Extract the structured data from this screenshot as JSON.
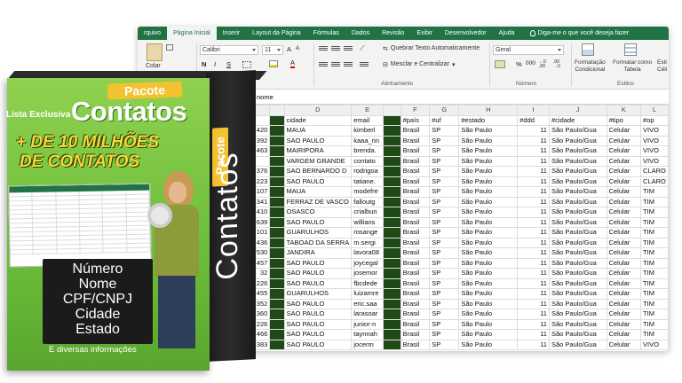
{
  "excel": {
    "menu": [
      "rquivo",
      "Página Inicial",
      "Inserir",
      "Layout da Página",
      "Fórmulas",
      "Dados",
      "Revisão",
      "Exibir",
      "Desenvolvedor",
      "Ajuda"
    ],
    "active_menu": "Página Inicial",
    "tell_me": "Diga-me o que você deseja fazer",
    "ribbon": {
      "paste": "Colar",
      "font_name": "Calibri",
      "font_size": "11",
      "bold": "N",
      "italic": "I",
      "underline": "S",
      "grow_font": "A",
      "shrink_font": "A",
      "font_color": "A",
      "font_group_partial": "onte",
      "wrap_text": "Quebrar Texto Automaticamente",
      "merge_center": "Mesclar e Centralizar",
      "alignment_group": "Alinhamento",
      "number_format": "Geral",
      "percent": "%",
      "thousands": "000",
      "inc_decimal": "←0 ,00",
      "dec_decimal": ",00 →0",
      "number_group": "Número",
      "conditional": [
        "Formatação",
        "Condicional"
      ],
      "format_table": [
        "Formatar como",
        "Tabela"
      ],
      "cell_styles_partial": [
        "Esti",
        "Céli"
      ],
      "styles_group": "Estilos"
    },
    "formula_value": "nome",
    "columns": [
      "C",
      "D",
      "E",
      "F",
      "G",
      "H",
      "I",
      "J",
      "K",
      "L"
    ],
    "header_row": [
      "cnpj",
      "cidade",
      "email",
      "#país",
      "#uf",
      "#estado",
      "#ddd",
      "#cidade",
      "#tipo",
      "#op"
    ],
    "rows": [
      [
        "420",
        "MAUA",
        "kimberl",
        "Brasil",
        "SP",
        "São Paulo",
        "11",
        "São Paulo/Gua",
        "Celular",
        "VIVO"
      ],
      [
        "392",
        "SAO PAULO",
        "kaaa_rin",
        "Brasil",
        "SP",
        "São Paulo",
        "11",
        "São Paulo/Gua",
        "Celular",
        "VIVO"
      ],
      [
        "463",
        "MAIRIPORA",
        "brenda.",
        "Brasil",
        "SP",
        "São Paulo",
        "11",
        "São Paulo/Gua",
        "Celular",
        "VIVO"
      ],
      [
        "",
        "VARGEM GRANDE",
        "contato",
        "Brasil",
        "SP",
        "São Paulo",
        "11",
        "São Paulo/Gua",
        "Celular",
        "VIVO"
      ],
      [
        "376",
        "SAO BERNARDO D",
        "rodrigoa",
        "Brasil",
        "SP",
        "São Paulo",
        "11",
        "São Paulo/Gua",
        "Celular",
        "CLARO"
      ],
      [
        "223",
        "SAO PAULO",
        "tatiane.",
        "Brasil",
        "SP",
        "São Paulo",
        "11",
        "São Paulo/Gua",
        "Celular",
        "CLARO"
      ],
      [
        "107",
        "MAUA",
        "modefre",
        "Brasil",
        "SP",
        "São Paulo",
        "11",
        "São Paulo/Gua",
        "Celular",
        "TIM"
      ],
      [
        "341",
        "FERRAZ DE VASCO",
        "falloutg",
        "Brasil",
        "SP",
        "São Paulo",
        "11",
        "São Paulo/Gua",
        "Celular",
        "TIM"
      ],
      [
        "410",
        "OSASCO",
        "crialbun",
        "Brasil",
        "SP",
        "São Paulo",
        "11",
        "São Paulo/Gua",
        "Celular",
        "TIM"
      ],
      [
        "639",
        "SAO PAULO",
        "willians",
        "Brasil",
        "SP",
        "São Paulo",
        "11",
        "São Paulo/Gua",
        "Celular",
        "TIM"
      ],
      [
        "101",
        "GUARULHOS",
        "rosange",
        "Brasil",
        "SP",
        "São Paulo",
        "11",
        "São Paulo/Gua",
        "Celular",
        "TIM"
      ],
      [
        "436",
        "TABOAO DA SERRA",
        "m.sergi",
        "Brasil",
        "SP",
        "São Paulo",
        "11",
        "São Paulo/Gua",
        "Celular",
        "TIM"
      ],
      [
        "530",
        "JANDIRA",
        "lavora08",
        "Brasil",
        "SP",
        "São Paulo",
        "11",
        "São Paulo/Gua",
        "Celular",
        "TIM"
      ],
      [
        "457",
        "SAO PAULO",
        "joycegal",
        "Brasil",
        "SP",
        "São Paulo",
        "11",
        "São Paulo/Gua",
        "Celular",
        "TIM"
      ],
      [
        "32",
        "SAO PAULO",
        "josemor",
        "Brasil",
        "SP",
        "São Paulo",
        "11",
        "São Paulo/Gua",
        "Celular",
        "TIM"
      ],
      [
        "226",
        "SAO PAULO",
        "fbcdede",
        "Brasil",
        "SP",
        "São Paulo",
        "11",
        "São Paulo/Gua",
        "Celular",
        "TIM"
      ],
      [
        "455",
        "GUARULHOS",
        "luizamre",
        "Brasil",
        "SP",
        "São Paulo",
        "11",
        "São Paulo/Gua",
        "Celular",
        "TIM"
      ],
      [
        "352",
        "SAO PAULO",
        "eric.saa",
        "Brasil",
        "SP",
        "São Paulo",
        "11",
        "São Paulo/Gua",
        "Celular",
        "TIM"
      ],
      [
        "360",
        "SAO PAULO",
        "larasoar",
        "Brasil",
        "SP",
        "São Paulo",
        "11",
        "São Paulo/Gua",
        "Celular",
        "TIM"
      ],
      [
        "226",
        "SAO PAULO",
        "junior-n",
        "Brasil",
        "SP",
        "São Paulo",
        "11",
        "São Paulo/Gua",
        "Celular",
        "TIM"
      ],
      [
        "466",
        "SAO PAULO",
        "taynnah",
        "Brasil",
        "SP",
        "São Paulo",
        "11",
        "São Paulo/Gua",
        "Celular",
        "TIM"
      ],
      [
        "383",
        "SAO PAULO",
        "jocerm",
        "Brasil",
        "SP",
        "São Paulo",
        "11",
        "São Paulo/Gua",
        "Celular",
        "VIVO"
      ]
    ]
  },
  "box": {
    "pacote": "Pacote",
    "lista": "Lista Exclusiva",
    "title": "Contatos",
    "headline1": "+ DE 10 MILHÕES",
    "headline2": "DE CONTATOS",
    "fields": [
      "Número",
      "Nome",
      "CPF/CNPJ",
      "Cidade",
      "Estado"
    ],
    "footer": "E diversas informações",
    "side_pacote": "Pacote",
    "side_title": "Contatos"
  }
}
